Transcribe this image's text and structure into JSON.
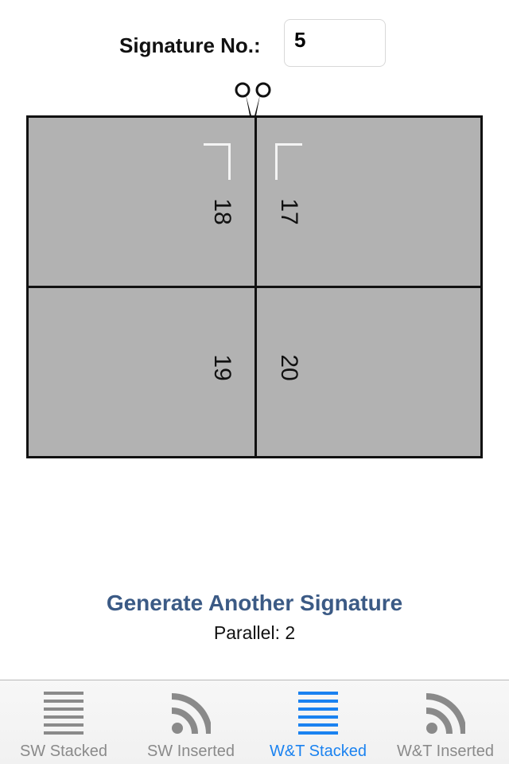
{
  "signature": {
    "label": "Signature No.:",
    "value": "5"
  },
  "sheet": {
    "pages": {
      "top_left": "18",
      "top_right": "17",
      "bottom_left": "19",
      "bottom_right": "20"
    }
  },
  "actions": {
    "generate_label": "Generate Another Signature",
    "parallel_text": "Parallel: 2"
  },
  "tabs": [
    {
      "label": "SW Stacked",
      "icon": "lines-icon",
      "active": false
    },
    {
      "label": "SW Inserted",
      "icon": "feed-icon",
      "active": false
    },
    {
      "label": "W&T Stacked",
      "icon": "lines-icon",
      "active": true
    },
    {
      "label": "W&T Inserted",
      "icon": "feed-icon",
      "active": false
    }
  ],
  "colors": {
    "accent": "#1a82f0",
    "button_text": "#3b5a85",
    "sheet_fill": "#b2b2b2",
    "inactive_tab": "#8a8a8a"
  }
}
